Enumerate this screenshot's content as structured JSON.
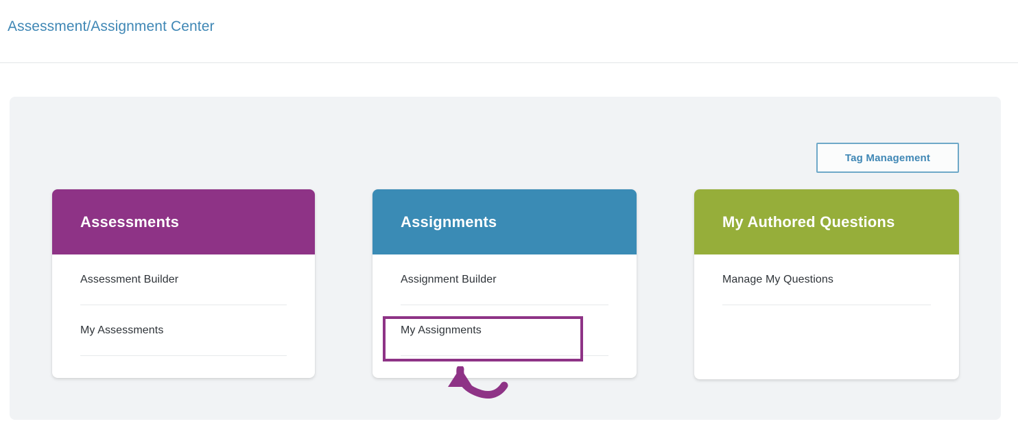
{
  "header": {
    "title": "Assessment/Assignment Center"
  },
  "toolbar": {
    "tag_management_label": "Tag Management"
  },
  "colors": {
    "title_blue": "#3f87b5",
    "assessments_purple": "#8e3386",
    "assignments_blue": "#3a8bb5",
    "questions_green": "#96ae3a",
    "panel_background": "#f1f3f5",
    "annotation_purple": "#8e3386",
    "button_border_blue": "#6ea8c8",
    "item_text": "#2e3338",
    "divider": "#e6e9eb"
  },
  "cards": [
    {
      "title": "Assessments",
      "accent": "#8e3386",
      "items": [
        {
          "label": "Assessment Builder"
        },
        {
          "label": "My Assessments"
        }
      ]
    },
    {
      "title": "Assignments",
      "accent": "#3a8bb5",
      "items": [
        {
          "label": "Assignment Builder"
        },
        {
          "label": "My Assignments"
        }
      ]
    },
    {
      "title": "My Authored Questions",
      "accent": "#96ae3a",
      "items": [
        {
          "label": "Manage My Questions"
        }
      ]
    }
  ],
  "annotations": {
    "highlight_target": "My Assignments",
    "arrow": "curved-arrow-up-left",
    "arrow_color": "#8e3386"
  }
}
